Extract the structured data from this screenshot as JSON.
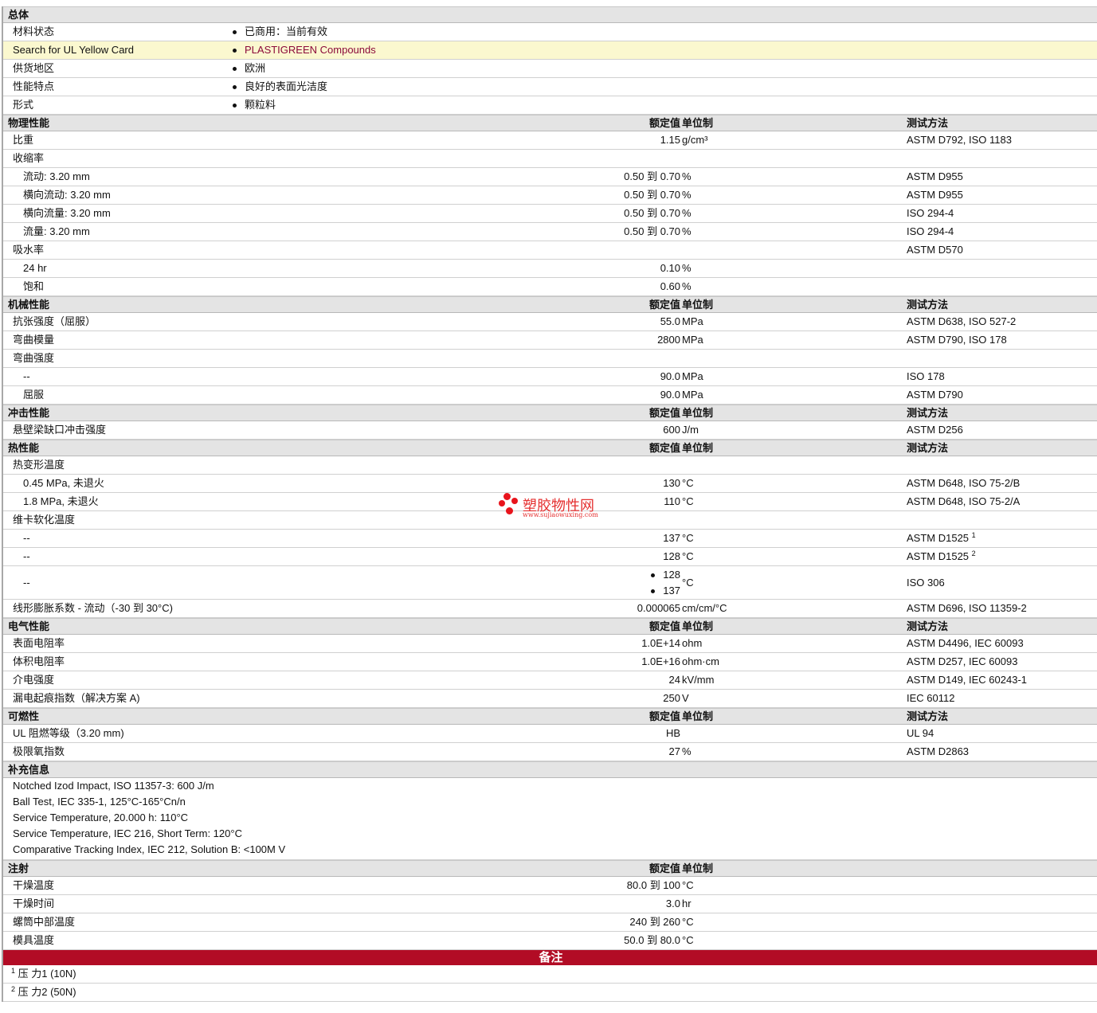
{
  "col_headers": {
    "value": "额定值",
    "unit": "单位制",
    "method": "测试方法"
  },
  "general": {
    "title": "总体",
    "rows": [
      {
        "label": "材料状态",
        "value": "已商用：当前有效"
      },
      {
        "label": "Search for UL Yellow Card",
        "value": "PLASTIGREEN Compounds",
        "link": true
      },
      {
        "label": "供货地区",
        "value": "欧洲"
      },
      {
        "label": "性能特点",
        "value": "良好的表面光洁度"
      },
      {
        "label": "形式",
        "value": "颗粒料"
      }
    ]
  },
  "sections": [
    {
      "title": "物理性能",
      "rows": [
        {
          "label": "比重",
          "value": "1.15",
          "unit": "g/cm³",
          "method": "ASTM D792, ISO 1183"
        },
        {
          "label": "收缩率"
        },
        {
          "label": "流动: 3.20 mm",
          "indent": true,
          "value": "0.50 到  0.70",
          "unit": "%",
          "method": "ASTM D955"
        },
        {
          "label": "横向流动: 3.20 mm",
          "indent": true,
          "value": "0.50 到  0.70",
          "unit": "%",
          "method": "ASTM D955"
        },
        {
          "label": "横向流量: 3.20 mm",
          "indent": true,
          "value": "0.50 到  0.70",
          "unit": "%",
          "method": "ISO 294-4"
        },
        {
          "label": "流量: 3.20 mm",
          "indent": true,
          "value": "0.50 到  0.70",
          "unit": "%",
          "method": "ISO 294-4"
        },
        {
          "label": "吸水率",
          "method": "ASTM D570"
        },
        {
          "label": "24 hr",
          "indent": true,
          "value": "0.10",
          "unit": "%"
        },
        {
          "label": "饱和",
          "indent": true,
          "value": "0.60",
          "unit": "%"
        }
      ]
    },
    {
      "title": "机械性能",
      "rows": [
        {
          "label": "抗张强度（屈服）",
          "value": "55.0",
          "unit": "MPa",
          "method": "ASTM D638, ISO 527-2"
        },
        {
          "label": "弯曲模量",
          "value": "2800",
          "unit": "MPa",
          "method": "ASTM D790, ISO 178"
        },
        {
          "label": "弯曲强度"
        },
        {
          "label": "--",
          "indent": true,
          "value": "90.0",
          "unit": "MPa",
          "method": "ISO 178"
        },
        {
          "label": "屈服",
          "indent": true,
          "value": "90.0",
          "unit": "MPa",
          "method": "ASTM D790"
        }
      ]
    },
    {
      "title": "冲击性能",
      "rows": [
        {
          "label": "悬壁梁缺口冲击强度",
          "value": "600",
          "unit": "J/m",
          "method": "ASTM D256"
        }
      ]
    },
    {
      "title": "热性能",
      "rows": [
        {
          "label": "热变形温度"
        },
        {
          "label": "0.45 MPa, 未退火",
          "indent": true,
          "value": "130",
          "unit": "°C",
          "method": "ASTM D648, ISO 75-2/B"
        },
        {
          "label": "1.8 MPa, 未退火",
          "indent": true,
          "value": "110",
          "unit": "°C",
          "method": "ASTM D648, ISO 75-2/A"
        },
        {
          "label": "维卡软化温度"
        },
        {
          "label": "--",
          "indent": true,
          "value": "137",
          "unit": "°C",
          "method": "ASTM D1525",
          "sup": "1"
        },
        {
          "label": "--",
          "indent": true,
          "value": "128",
          "unit": "°C",
          "method": "ASTM D1525",
          "sup": "2"
        },
        {
          "label": "--",
          "indent": true,
          "values": [
            "128",
            "137"
          ],
          "unit": "°C",
          "method": "ISO 306"
        },
        {
          "label": "线形膨胀系数 - 流动（-30 到  30°C)",
          "value": "0.000065",
          "unit": "cm/cm/°C",
          "method": "ASTM D696, ISO 11359-2"
        }
      ]
    },
    {
      "title": "电气性能",
      "rows": [
        {
          "label": "表面电阻率",
          "value": "1.0E+14",
          "unit": "ohm",
          "method": "ASTM D4496, IEC 60093"
        },
        {
          "label": "体积电阻率",
          "value": "1.0E+16",
          "unit": "ohm·cm",
          "method": "ASTM D257, IEC 60093"
        },
        {
          "label": "介电强度",
          "value": "24",
          "unit": "kV/mm",
          "method": "ASTM D149, IEC 60243-1"
        },
        {
          "label": "漏电起痕指数（解决方案  A)",
          "value": "250",
          "unit": "V",
          "method": "IEC 60112"
        }
      ]
    },
    {
      "title": "可燃性",
      "rows": [
        {
          "label": "UL 阻燃等级（3.20 mm)",
          "value": "HB",
          "method": "UL 94"
        },
        {
          "label": "极限氧指数",
          "value": "27",
          "unit": "%",
          "method": "ASTM D2863"
        }
      ]
    }
  ],
  "supplementary": {
    "title": "补充信息",
    "lines": [
      "Notched Izod Impact, ISO 11357-3: 600 J/m",
      "Ball Test, IEC 335-1, 125°C-165°Cn/n",
      "Service Temperature, 20.000 h: 110°C",
      "Service Temperature, IEC 216, Short Term: 120°C",
      "Comparative Tracking Index, IEC 212, Solution B: <100M V"
    ]
  },
  "injection": {
    "title": "注射",
    "rows": [
      {
        "label": "干燥温度",
        "value": "80.0 到  100",
        "unit": "°C"
      },
      {
        "label": "干燥时间",
        "value": "3.0",
        "unit": "hr"
      },
      {
        "label": "螺筒中部温度",
        "value": "240 到  260",
        "unit": "°C"
      },
      {
        "label": "模具温度",
        "value": "50.0 到  80.0",
        "unit": "°C"
      }
    ]
  },
  "notes": {
    "title": "备注",
    "items": [
      {
        "sup": "1",
        "text": "压  力1 (10N)"
      },
      {
        "sup": "2",
        "text": "压  力2 (50N)"
      }
    ]
  },
  "watermark": {
    "name": "塑胶物性网",
    "url": "www.sujiaowuxing.com"
  }
}
